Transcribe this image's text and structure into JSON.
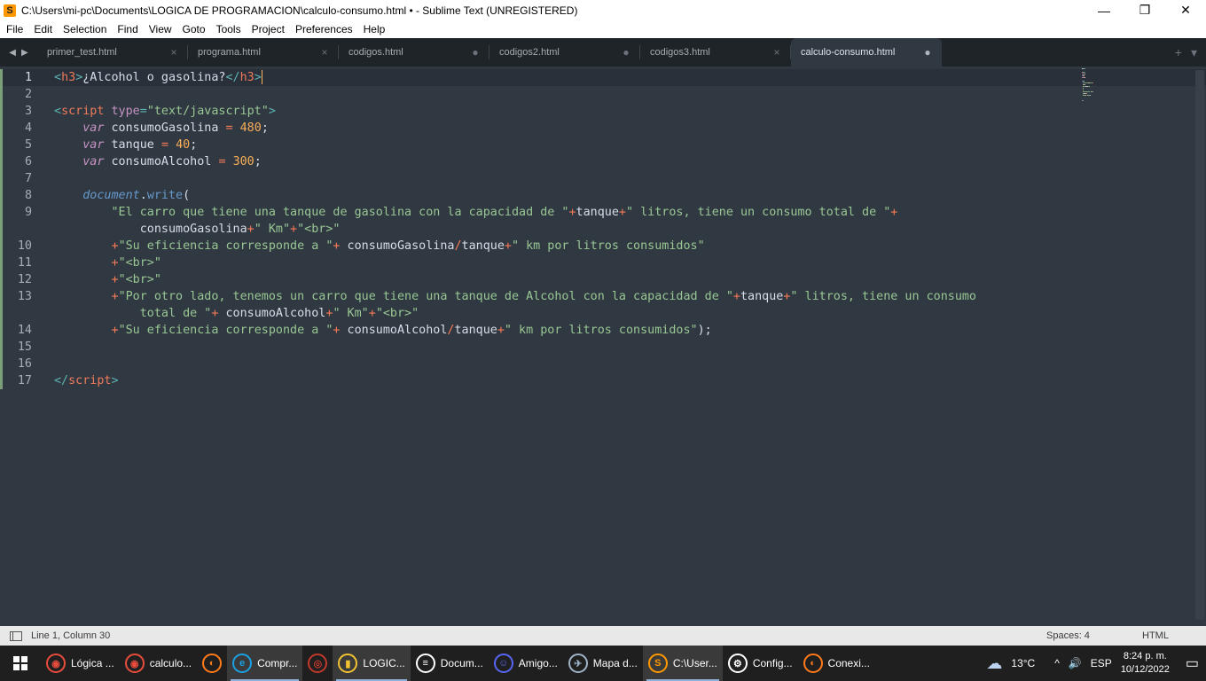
{
  "window": {
    "title": "C:\\Users\\mi-pc\\Documents\\LOGICA DE PROGRAMACION\\calculo-consumo.html • - Sublime Text (UNREGISTERED)",
    "app_icon_glyph": "S",
    "minimize": "—",
    "maximize": "❐",
    "close": "✕"
  },
  "menu": [
    "File",
    "Edit",
    "Selection",
    "Find",
    "View",
    "Goto",
    "Tools",
    "Project",
    "Preferences",
    "Help"
  ],
  "tabs": [
    {
      "label": "primer_test.html",
      "marker": "×",
      "active": false
    },
    {
      "label": "programa.html",
      "marker": "×",
      "active": false
    },
    {
      "label": "codigos.html",
      "marker": "●",
      "active": false
    },
    {
      "label": "codigos2.html",
      "marker": "●",
      "active": false
    },
    {
      "label": "codigos3.html",
      "marker": "×",
      "active": false
    },
    {
      "label": "calculo-consumo.html",
      "marker": "●",
      "active": true
    }
  ],
  "tabbar_icons": {
    "nav_left": "◀",
    "nav_right": "▶",
    "add": "+",
    "dropdown": "▾"
  },
  "editor": {
    "current_line": 1,
    "lines": [
      {
        "n": "1",
        "tokens": [
          [
            "t-punct",
            "<"
          ],
          [
            "t-tag",
            "h3"
          ],
          [
            "t-punct",
            ">"
          ],
          [
            "t-plain",
            "¿Alcohol o gasolina?"
          ],
          [
            "t-punct",
            "</"
          ],
          [
            "t-tag",
            "h3"
          ],
          [
            "t-punct",
            ">"
          ]
        ],
        "cursor": true
      },
      {
        "n": "2",
        "tokens": []
      },
      {
        "n": "3",
        "tokens": [
          [
            "t-punct",
            "<"
          ],
          [
            "t-tag",
            "script"
          ],
          [
            "t-plain",
            " "
          ],
          [
            "t-attr",
            "type"
          ],
          [
            "t-punct",
            "="
          ],
          [
            "t-str",
            "\"text/javascript\""
          ],
          [
            "t-punct",
            ">"
          ]
        ]
      },
      {
        "n": "4",
        "tokens": [
          [
            "t-plain",
            "    "
          ],
          [
            "t-kw",
            "var"
          ],
          [
            "t-plain",
            " consumoGasolina "
          ],
          [
            "t-op",
            "="
          ],
          [
            "t-plain",
            " "
          ],
          [
            "t-num",
            "480"
          ],
          [
            "t-plain",
            ";"
          ]
        ]
      },
      {
        "n": "5",
        "tokens": [
          [
            "t-plain",
            "    "
          ],
          [
            "t-kw",
            "var"
          ],
          [
            "t-plain",
            " tanque "
          ],
          [
            "t-op",
            "="
          ],
          [
            "t-plain",
            " "
          ],
          [
            "t-num",
            "40"
          ],
          [
            "t-plain",
            ";"
          ]
        ]
      },
      {
        "n": "6",
        "tokens": [
          [
            "t-plain",
            "    "
          ],
          [
            "t-kw",
            "var"
          ],
          [
            "t-plain",
            " consumoAlcohol "
          ],
          [
            "t-op",
            "="
          ],
          [
            "t-plain",
            " "
          ],
          [
            "t-num",
            "300"
          ],
          [
            "t-plain",
            ";"
          ]
        ]
      },
      {
        "n": "7",
        "tokens": []
      },
      {
        "n": "8",
        "tokens": [
          [
            "t-plain",
            "    "
          ],
          [
            "t-fn",
            "document"
          ],
          [
            "t-plain",
            "."
          ],
          [
            "t-fn2",
            "write"
          ],
          [
            "t-plain",
            "("
          ]
        ]
      },
      {
        "n": "9",
        "tokens": [
          [
            "t-plain",
            "        "
          ],
          [
            "t-str",
            "\"El carro que tiene una tanque de gasolina con la capacidad de \""
          ],
          [
            "t-op",
            "+"
          ],
          [
            "t-plain",
            "tanque"
          ],
          [
            "t-op",
            "+"
          ],
          [
            "t-str",
            "\" litros, tiene un consumo total de \""
          ],
          [
            "t-op",
            "+"
          ]
        ]
      },
      {
        "n": "",
        "tokens": [
          [
            "t-plain",
            "            consumoGasolina"
          ],
          [
            "t-op",
            "+"
          ],
          [
            "t-str",
            "\" Km\""
          ],
          [
            "t-op",
            "+"
          ],
          [
            "t-str",
            "\"<br>\""
          ]
        ]
      },
      {
        "n": "10",
        "tokens": [
          [
            "t-plain",
            "        "
          ],
          [
            "t-op",
            "+"
          ],
          [
            "t-str",
            "\"Su eficiencia corresponde a \""
          ],
          [
            "t-op",
            "+"
          ],
          [
            "t-plain",
            " consumoGasolina"
          ],
          [
            "t-op",
            "/"
          ],
          [
            "t-plain",
            "tanque"
          ],
          [
            "t-op",
            "+"
          ],
          [
            "t-str",
            "\" km por litros consumidos\""
          ]
        ]
      },
      {
        "n": "11",
        "tokens": [
          [
            "t-plain",
            "        "
          ],
          [
            "t-op",
            "+"
          ],
          [
            "t-str",
            "\"<br>\""
          ]
        ]
      },
      {
        "n": "12",
        "tokens": [
          [
            "t-plain",
            "        "
          ],
          [
            "t-op",
            "+"
          ],
          [
            "t-str",
            "\"<br>\""
          ]
        ]
      },
      {
        "n": "13",
        "tokens": [
          [
            "t-plain",
            "        "
          ],
          [
            "t-op",
            "+"
          ],
          [
            "t-str",
            "\"Por otro lado, tenemos un carro que tiene una tanque de Alcohol con la capacidad de \""
          ],
          [
            "t-op",
            "+"
          ],
          [
            "t-plain",
            "tanque"
          ],
          [
            "t-op",
            "+"
          ],
          [
            "t-str",
            "\" litros, tiene un consumo"
          ]
        ]
      },
      {
        "n": "",
        "tokens": [
          [
            "t-str",
            "            total de \""
          ],
          [
            "t-op",
            "+"
          ],
          [
            "t-plain",
            " consumoAlcohol"
          ],
          [
            "t-op",
            "+"
          ],
          [
            "t-str",
            "\" Km\""
          ],
          [
            "t-op",
            "+"
          ],
          [
            "t-str",
            "\"<br>\""
          ]
        ]
      },
      {
        "n": "14",
        "tokens": [
          [
            "t-plain",
            "        "
          ],
          [
            "t-op",
            "+"
          ],
          [
            "t-str",
            "\"Su eficiencia corresponde a \""
          ],
          [
            "t-op",
            "+"
          ],
          [
            "t-plain",
            " consumoAlcohol"
          ],
          [
            "t-op",
            "/"
          ],
          [
            "t-plain",
            "tanque"
          ],
          [
            "t-op",
            "+"
          ],
          [
            "t-str",
            "\" km por litros consumidos\""
          ],
          [
            "t-plain",
            ");"
          ]
        ]
      },
      {
        "n": "15",
        "tokens": []
      },
      {
        "n": "16",
        "tokens": []
      },
      {
        "n": "17",
        "tokens": [
          [
            "t-punct",
            "</"
          ],
          [
            "t-tag",
            "script"
          ],
          [
            "t-punct",
            ">"
          ]
        ]
      }
    ]
  },
  "statusbar": {
    "position": "Line 1, Column 30",
    "spaces": "Spaces: 4",
    "syntax": "HTML"
  },
  "taskbar": {
    "items": [
      {
        "label": "Lógica ...",
        "icon": "chrome-icon",
        "color": "#e74c3c",
        "glyph": "◉",
        "active": false
      },
      {
        "label": "calculo...",
        "icon": "chrome-icon",
        "color": "#e74c3c",
        "glyph": "◉",
        "active": false
      },
      {
        "label": "",
        "icon": "firefox-icon",
        "color": "#ff7a1a",
        "glyph": "◐",
        "active": false
      },
      {
        "label": "Compr...",
        "icon": "edge-icon",
        "color": "#1ba1e2",
        "glyph": "e",
        "active": true
      },
      {
        "label": "",
        "icon": "record-icon",
        "color": "#c0392b",
        "glyph": "◎",
        "active": false
      },
      {
        "label": "LOGIC...",
        "icon": "folder-icon",
        "color": "#f1c232",
        "glyph": "▮",
        "active": true
      },
      {
        "label": "Docum...",
        "icon": "document-icon",
        "color": "#ffffff",
        "glyph": "≡",
        "active": false
      },
      {
        "label": "Amigo...",
        "icon": "discord-icon",
        "color": "#5865f2",
        "glyph": "☺",
        "active": false
      },
      {
        "label": "Mapa d...",
        "icon": "map-icon",
        "color": "#9fb3c8",
        "glyph": "✈",
        "active": false
      },
      {
        "label": "C:\\User...",
        "icon": "sublime-icon",
        "color": "#ff9800",
        "glyph": "S",
        "active": true
      },
      {
        "label": "Config...",
        "icon": "settings-icon",
        "color": "#ffffff",
        "glyph": "⚙",
        "active": false
      },
      {
        "label": "Conexi...",
        "icon": "firefox-icon",
        "color": "#ff7a1a",
        "glyph": "◐",
        "active": false
      }
    ],
    "weather": "13°C",
    "tray_up": "^",
    "volume": "🔊",
    "language": "ESP",
    "time": "8:24 p. m.",
    "date": "10/12/2022",
    "notification": "▭"
  }
}
